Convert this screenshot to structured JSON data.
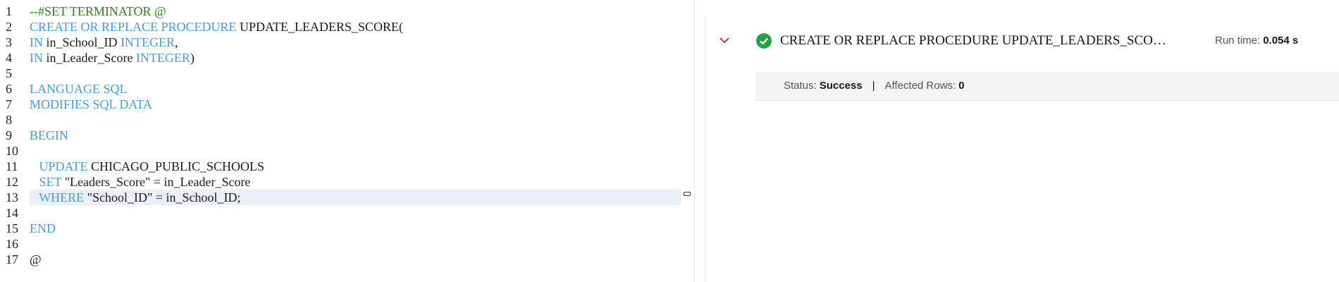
{
  "editor": {
    "lines": [
      {
        "num": "1",
        "tokens": [
          {
            "t": "--#SET TERMINATOR @",
            "c": "cm"
          }
        ]
      },
      {
        "num": "2",
        "tokens": [
          {
            "t": "CREATE OR REPLACE PROCEDURE",
            "c": "kw"
          },
          {
            "t": " UPDATE_LEADERS_SCORE(",
            "c": "tx"
          }
        ]
      },
      {
        "num": "3",
        "tokens": [
          {
            "t": "IN",
            "c": "kw"
          },
          {
            "t": " in_School_ID ",
            "c": "tx"
          },
          {
            "t": "INTEGER",
            "c": "kw"
          },
          {
            "t": ",",
            "c": "tx"
          }
        ]
      },
      {
        "num": "4",
        "tokens": [
          {
            "t": "IN",
            "c": "kw"
          },
          {
            "t": " in_Leader_Score ",
            "c": "tx"
          },
          {
            "t": "INTEGER",
            "c": "kw"
          },
          {
            "t": ")",
            "c": "tx"
          }
        ]
      },
      {
        "num": "5",
        "tokens": []
      },
      {
        "num": "6",
        "tokens": [
          {
            "t": "LANGUAGE SQL",
            "c": "kw"
          }
        ]
      },
      {
        "num": "7",
        "tokens": [
          {
            "t": "MODIFIES SQL DATA",
            "c": "kw"
          }
        ]
      },
      {
        "num": "8",
        "tokens": []
      },
      {
        "num": "9",
        "tokens": [
          {
            "t": "BEGIN",
            "c": "kw"
          }
        ]
      },
      {
        "num": "10",
        "tokens": []
      },
      {
        "num": "11",
        "tokens": [
          {
            "t": "   ",
            "c": "tx"
          },
          {
            "t": "UPDATE",
            "c": "kw"
          },
          {
            "t": " CHICAGO_PUBLIC_SCHOOLS",
            "c": "tx"
          }
        ]
      },
      {
        "num": "12",
        "tokens": [
          {
            "t": "   ",
            "c": "tx"
          },
          {
            "t": "SET",
            "c": "kw"
          },
          {
            "t": " \"Leaders_Score\" = in_Leader_Score",
            "c": "tx"
          }
        ]
      },
      {
        "num": "13",
        "tokens": [
          {
            "t": "   ",
            "c": "tx"
          },
          {
            "t": "WHERE",
            "c": "kw"
          },
          {
            "t": " \"School_ID\" = in_School_ID;",
            "c": "tx"
          }
        ],
        "current": true
      },
      {
        "num": "14",
        "tokens": []
      },
      {
        "num": "15",
        "tokens": [
          {
            "t": "END",
            "c": "kw"
          }
        ]
      },
      {
        "num": "16",
        "tokens": []
      },
      {
        "num": "17",
        "tokens": [
          {
            "t": "@",
            "c": "tx"
          }
        ]
      }
    ]
  },
  "result": {
    "query_title": "CREATE OR REPLACE PROCEDURE UPDATE_LEADERS_SCOR…",
    "run_time_label": "Run time:",
    "run_time_value": "0.054 s",
    "status_label": "Status:",
    "status_value": "Success",
    "separator": "|",
    "affected_label": "Affected Rows:",
    "affected_value": "0",
    "status_icon": "success-check-icon",
    "collapse_icon": "chevron-down-icon",
    "colors": {
      "success": "#24a148",
      "chevron": "#da1e28",
      "keyword": "#4a9bd9",
      "comment": "#2e7d1a"
    }
  }
}
